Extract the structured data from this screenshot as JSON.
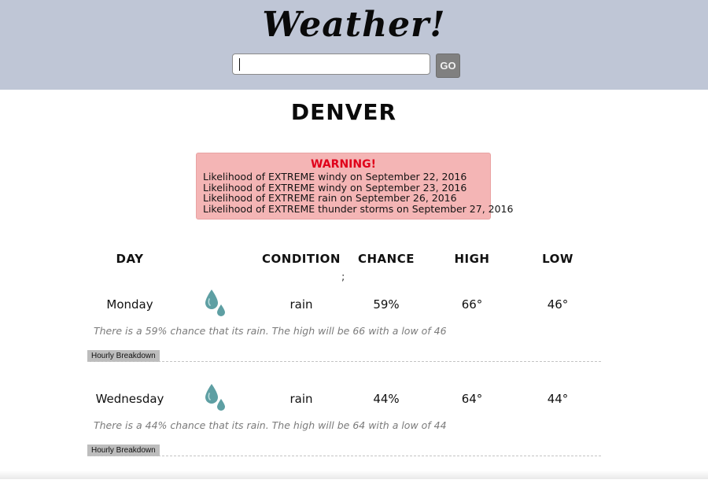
{
  "header": {
    "title": "Weather!",
    "search_value": "",
    "go_label": "GO"
  },
  "city": "DENVER",
  "warning": {
    "title": "WARNING!",
    "lines": [
      "Likelihood of EXTREME windy on September 22, 2016",
      "Likelihood of EXTREME windy on September 23, 2016",
      "Likelihood of EXTREME rain on September 26, 2016",
      "Likelihood of EXTREME thunder storms on September 27, 2016"
    ]
  },
  "table": {
    "headers": {
      "day": "DAY",
      "condition": "CONDITION",
      "chance": "CHANCE",
      "high": "HIGH",
      "low": "LOW"
    },
    "stray_mark": ";",
    "hourly_label": "Hourly Breakdown",
    "rows": [
      {
        "day": "Monday",
        "icon": "rain-drops-icon",
        "condition": "rain",
        "chance": "59%",
        "high": "66°",
        "low": "46°",
        "description": "There is a 59% chance that its rain. The high will be 66 with a low of 46"
      },
      {
        "day": "Wednesday",
        "icon": "rain-drops-icon",
        "condition": "rain",
        "chance": "44%",
        "high": "64°",
        "low": "44°",
        "description": "There is a 44% chance that its rain. The high will be 64 with a low of 44"
      }
    ]
  },
  "colors": {
    "header_bg": "#bfc6d6",
    "warning_bg": "#f4b5b5",
    "warning_title": "#e0001a",
    "drop_icon": "#5e9fa3",
    "go_button": "#808080"
  }
}
